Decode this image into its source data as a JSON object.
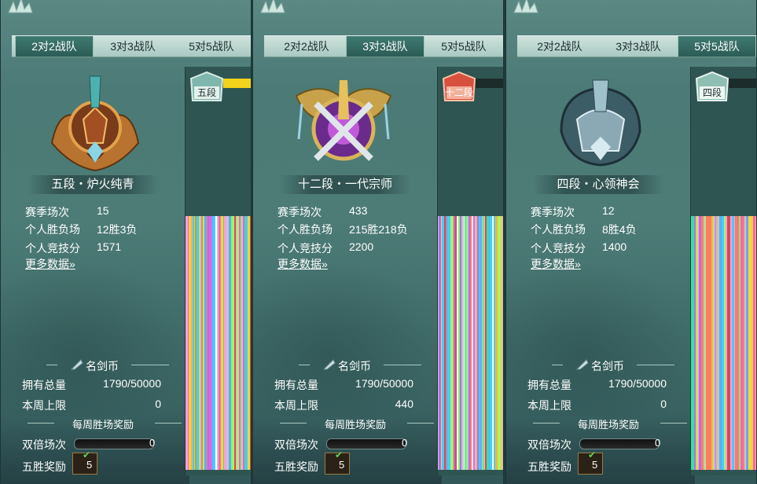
{
  "tabs": [
    {
      "label": "2对2战队"
    },
    {
      "label": "3对3战队"
    },
    {
      "label": "5对5战队"
    }
  ],
  "panels": [
    {
      "active_tab": 0,
      "rank_title": "五段・炉火纯青",
      "rank_short": "五段",
      "stats": {
        "season_label": "赛季场次",
        "season": "15",
        "record_label": "个人胜负场",
        "record": "12胜3负",
        "score_label": "个人竞技分",
        "score": "1571",
        "more": "更多数据"
      },
      "coin": {
        "title": "名剑币",
        "total_label": "拥有总量",
        "total": "1790/50000",
        "weekly_label": "本周上限",
        "weekly": "0"
      },
      "weekly_reward": {
        "title": "每周胜场奖励",
        "double_label": "双倍场次",
        "double_value": "0",
        "five_label": "五胜奖励",
        "reward_count": "5"
      },
      "colors": {
        "side_top": "#f2d21a",
        "chest": "#7fb6ad"
      }
    },
    {
      "active_tab": 1,
      "rank_title": "十二段・一代宗师",
      "rank_short": "十二段",
      "stats": {
        "season_label": "赛季场次",
        "season": "433",
        "record_label": "个人胜负场",
        "record": "215胜218负",
        "score_label": "个人竞技分",
        "score": "2200",
        "more": "更多数据"
      },
      "coin": {
        "title": "名剑币",
        "total_label": "拥有总量",
        "total": "1790/50000",
        "weekly_label": "本周上限",
        "weekly": "440"
      },
      "weekly_reward": {
        "title": "每周胜场奖励",
        "double_label": "双倍场次",
        "double_value": "0",
        "five_label": "五胜奖励",
        "reward_count": "5"
      },
      "colors": {
        "side_top": "#1c2c2a",
        "chest": "#d8503e"
      }
    },
    {
      "active_tab": 2,
      "rank_title": "四段・心领神会",
      "rank_short": "四段",
      "stats": {
        "season_label": "赛季场次",
        "season": "12",
        "record_label": "个人胜负场",
        "record": "8胜4负",
        "score_label": "个人竞技分",
        "score": "1400",
        "more": "更多数据"
      },
      "coin": {
        "title": "名剑币",
        "total_label": "拥有总量",
        "total": "1790/50000",
        "weekly_label": "本周上限",
        "weekly": "0"
      },
      "weekly_reward": {
        "title": "每周胜场奖励",
        "double_label": "双倍场次",
        "double_value": "0",
        "five_label": "五胜奖励",
        "reward_count": "5"
      },
      "colors": {
        "side_top": "#1c2c2a",
        "chest": "#8fbfb3"
      }
    }
  ],
  "icons": {
    "more_arrow": "»",
    "check": "✔"
  }
}
